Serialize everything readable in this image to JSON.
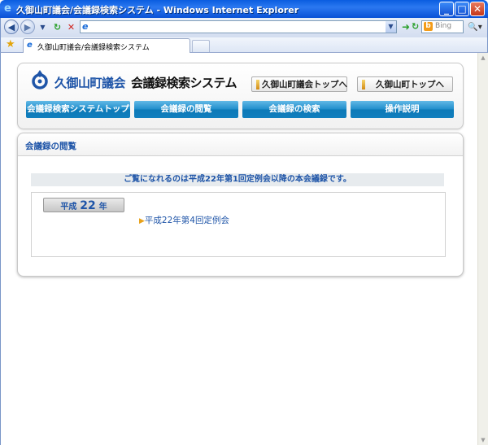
{
  "window": {
    "title": "久御山町議会/会議録検索システム - Windows Internet Explorer",
    "minimize_label": "_",
    "maximize_label": "□",
    "close_label": "✕"
  },
  "browser": {
    "search_placeholder": "Bing",
    "tab_label": "久御山町議会/会議録検索システム"
  },
  "header": {
    "site_name": "久御山町議会",
    "system_name": "会議録検索システム",
    "links": [
      "久御山町議会トップへ",
      "久御山町トップへ"
    ]
  },
  "nav": {
    "items": [
      "会議録検索システムトップ",
      "会議録の閲覧",
      "会議録の検索",
      "操作説明"
    ]
  },
  "main": {
    "section_title": "会議録の閲覧",
    "notice": "ご覧になれるのは平成22年第1回定例会以降の本会議録です。",
    "era_prefix": "平成",
    "era_number": "22",
    "era_suffix": "年",
    "sessions": [
      "平成22年第4回定例会"
    ]
  },
  "colors": {
    "accent_blue": "#1f55a8",
    "nav_blue": "#1e8dcb",
    "title_bar": "#0a5de0"
  }
}
